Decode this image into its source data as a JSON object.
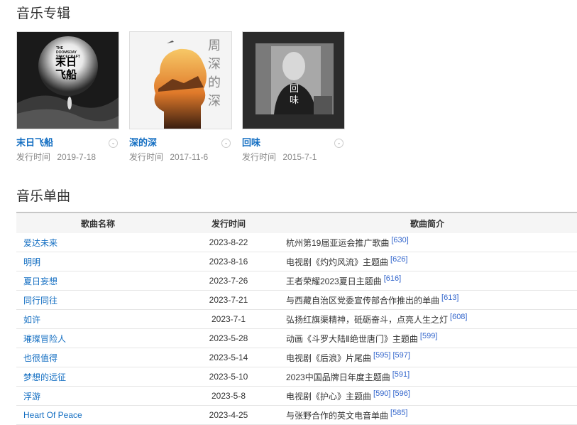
{
  "albums_section": {
    "title": "音乐专辑",
    "albums": [
      {
        "name": "末日飞船",
        "date_label": "发行时间",
        "date": "2019-7-18",
        "cover_text_en": "THE DOOMSDAY SPACECRAFT",
        "cover_text": "末日飞船"
      },
      {
        "name": "深的深",
        "date_label": "发行时间",
        "date": "2017-11-6",
        "cover_text": "周深的深"
      },
      {
        "name": "回味",
        "date_label": "发行时间",
        "date": "2015-7-1",
        "cover_text": "回味"
      }
    ]
  },
  "singles_section": {
    "title": "音乐单曲",
    "headers": [
      "歌曲名称",
      "发行时间",
      "歌曲简介"
    ],
    "rows": [
      {
        "song": "爱达未来",
        "date": "2023-8-22",
        "desc": "杭州第19届亚运会推广歌曲",
        "refs": [
          "[630]"
        ]
      },
      {
        "song": "明明",
        "date": "2023-8-16",
        "desc": "电视剧《灼灼风流》主题曲",
        "refs": [
          "[626]"
        ]
      },
      {
        "song": "夏日妄想",
        "date": "2023-7-26",
        "desc": "王者荣耀2023夏日主题曲",
        "refs": [
          "[616]"
        ]
      },
      {
        "song": "同行同往",
        "date": "2023-7-21",
        "desc": "与西藏自治区党委宣传部合作推出的单曲",
        "refs": [
          "[613]"
        ]
      },
      {
        "song": "如许",
        "date": "2023-7-1",
        "desc": "弘扬红旗渠精神，砥砺奋斗，点亮人生之灯",
        "refs": [
          "[608]"
        ]
      },
      {
        "song": "璀璨冒险人",
        "date": "2023-5-28",
        "desc": "动画《斗罗大陆Ⅱ绝世唐门》主题曲",
        "refs": [
          "[599]"
        ]
      },
      {
        "song": "也很值得",
        "date": "2023-5-14",
        "desc": "电视剧《后浪》片尾曲",
        "refs": [
          "[595]",
          "[597]"
        ]
      },
      {
        "song": "梦想的远征",
        "date": "2023-5-10",
        "desc": "2023中国品牌日年度主题曲",
        "refs": [
          "[591]"
        ]
      },
      {
        "song": "浮游",
        "date": "2023-5-8",
        "desc": "电视剧《护心》主题曲",
        "refs": [
          "[590]",
          "[596]"
        ]
      },
      {
        "song": "Heart Of Peace",
        "date": "2023-4-25",
        "desc": "与张野合作的英文电音单曲",
        "refs": [
          "[585]"
        ]
      }
    ]
  }
}
